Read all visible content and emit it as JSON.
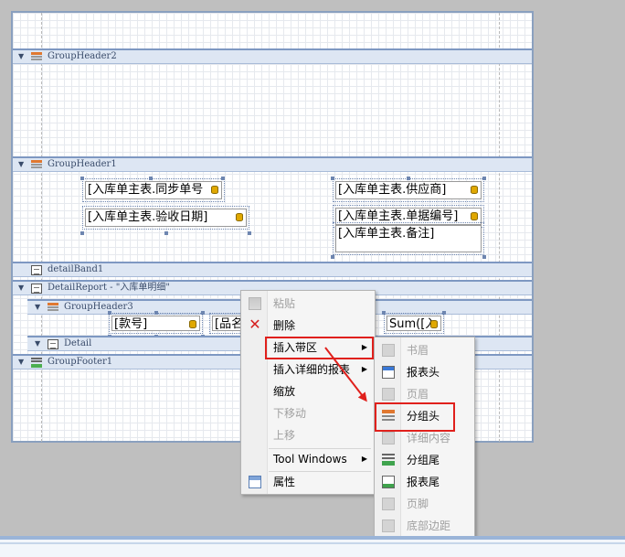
{
  "bands": {
    "group_header2": "GroupHeader2",
    "group_header1": "GroupHeader1",
    "detail_band1": "detailBand1",
    "detail_report": "DetailReport - \"入库单明细\"",
    "group_header3": "GroupHeader3",
    "detail": "Detail",
    "group_footer1": "GroupFooter1"
  },
  "fields": {
    "sync_no": "[入库单主表.同步单号",
    "acceptance_date": "[入库单主表.验收日期]",
    "supplier": "[入库单主表.供应商]",
    "doc_no": "[入库单主表.单据编号]",
    "remark": "[入库单主表.备注]",
    "item_no": "[款号]",
    "product_name": "[品名",
    "sum": "Sum([入"
  },
  "context_menu": {
    "paste": "粘贴",
    "delete": "删除",
    "insert_band": "插入带区",
    "insert_detail_report": "插入详细的报表",
    "zoom": "缩放",
    "move_down": "下移动",
    "move_up": "上移",
    "tool_windows": "Tool Windows",
    "properties": "属性"
  },
  "submenu": {
    "top_margin": "书眉",
    "report_header": "报表头",
    "page_header": "页眉",
    "group_header": "分组头",
    "detail": "详细内容",
    "group_footer": "分组尾",
    "report_footer": "报表尾",
    "page_footer": "页脚",
    "bottom_margin": "底部边距"
  },
  "colors": {
    "band_background": "#dde6f3",
    "band_border": "#7e98c2",
    "highlight": "#e0201c",
    "arrow": "#e0201c"
  }
}
